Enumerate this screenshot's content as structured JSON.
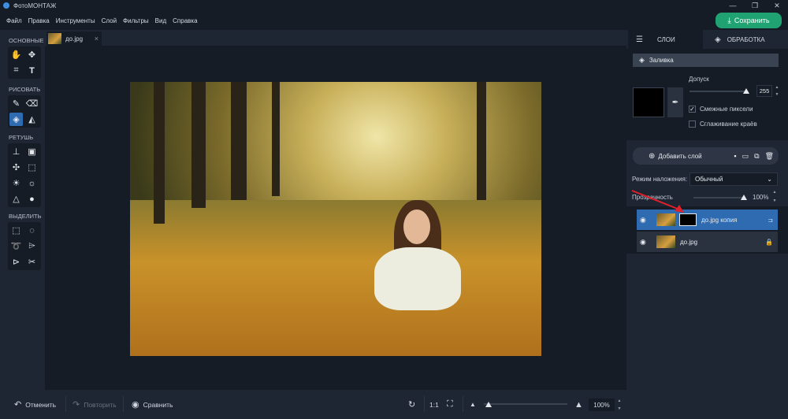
{
  "window": {
    "title": "ФотоМОНТАЖ",
    "controls": [
      "—",
      "❐",
      "✕"
    ]
  },
  "menu": {
    "items": [
      "Файл",
      "Правка",
      "Инструменты",
      "Слой",
      "Фильтры",
      "Вид",
      "Справка"
    ]
  },
  "save_button": {
    "label": "Сохранить",
    "icon": "download-icon",
    "color": "#1fa372"
  },
  "toolbox": {
    "groups": [
      {
        "label": "ОСНОВНЫЕ",
        "tools": [
          "hand-icon",
          "move-icon",
          "crop-icon",
          "text-icon"
        ]
      },
      {
        "label": "РИСОВАТЬ",
        "tools": [
          "brush-icon",
          "eraser-icon",
          "fill-bucket-icon",
          "shapes-icon"
        ]
      },
      {
        "label": "РЕТУШЬ",
        "tools": [
          "stamp-icon",
          "patch-icon",
          "healing-icon",
          "blur-icon",
          "dodge-icon",
          "burn-icon",
          "sharpen-icon",
          "drop-icon"
        ]
      },
      {
        "label": "ВЫДЕЛИТЬ",
        "tools": [
          "rect-select-icon",
          "ellipse-select-icon",
          "lasso-icon",
          "polygon-lasso-icon",
          "magnetic-lasso-icon",
          "magic-wand-icon"
        ]
      }
    ],
    "active_tool": "fill-bucket-icon"
  },
  "document_tab": {
    "name": "до.jpg",
    "close": "×"
  },
  "bottom_bar": {
    "undo": "Отменить",
    "redo": "Повторить",
    "compare": "Сравнить",
    "ratio": "1:1",
    "zoom": "100%",
    "zoom_level": 0.06
  },
  "right_panel": {
    "tabs": [
      {
        "label": "СЛОИ",
        "active": true
      },
      {
        "label": "ОБРАБОТКА",
        "active": false
      }
    ],
    "fill": {
      "header": "Заливка",
      "color": "#000000",
      "tolerance_label": "Допуск",
      "tolerance_value": "255",
      "tolerance_level": 1.0,
      "contiguous_label": "Смежные пиксели",
      "contiguous_checked": "✓",
      "antialias_label": "Сглаживание краёв"
    },
    "layers": {
      "add_label": "Добавить слой",
      "blend_label": "Режим наложения:",
      "blend_value": "Обычный",
      "opacity_label": "Прозрачность",
      "opacity_value": "100%",
      "opacity_level": 1.0,
      "items": [
        {
          "name": "до.jpg копия",
          "selected": true
        },
        {
          "name": "до.jpg",
          "selected": false
        }
      ]
    }
  },
  "colors": {
    "accent": "#2e6bb0",
    "arrow": "#e0202a"
  }
}
